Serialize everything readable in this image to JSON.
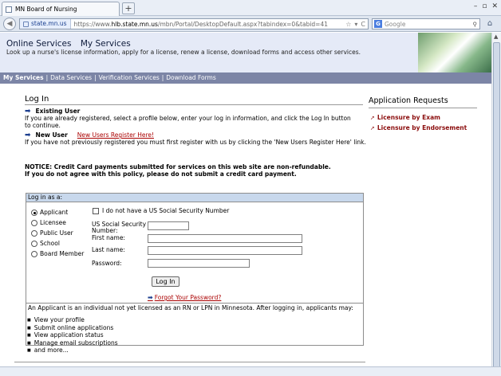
{
  "browser": {
    "tab_title": "MN Board of Nursing",
    "new_tab": "+",
    "window_buttons": [
      "–",
      "▫",
      "✕"
    ],
    "back": "◀",
    "site_identity": "state.mn.us",
    "url_prefix": "https://www.",
    "url_host": "hlb.state.mn.us",
    "url_rest": "/mbn/Portal/DesktopDefault.aspx?tabindex=0&tabid=41",
    "url_icons": [
      "☆",
      "▾",
      "C"
    ],
    "search_engine": "G",
    "search_placeholder": "Google",
    "search_icon": "⚲",
    "home_icon": "⌂"
  },
  "header": {
    "online_services": "Online Services",
    "my_services": "My Services",
    "tagline": "Look up a nurse's license information, apply for a license, renew a license, download forms and access other services."
  },
  "menu": {
    "items": [
      "My Services",
      "Data Services",
      "Verification Services",
      "Download Forms"
    ],
    "separator": "|"
  },
  "login": {
    "title": "Log In",
    "existing_user": "Existing User",
    "existing_text": "If you are already registered, select a profile below, enter your log in information, and click the Log In button to continue.",
    "new_user": "New User",
    "register_link": "New Users Register Here!",
    "new_text": "If you have not previously registered you must first register with us by clicking the 'New Users Register Here' link.",
    "notice1": "NOTICE: Credit Card payments submitted for services on this web site are non-refundable.",
    "notice2": "If you do not agree with this policy, please do not submit a credit card payment."
  },
  "form": {
    "heading": "Log in as a:",
    "profiles": [
      "Applicant",
      "Licensee",
      "Public User",
      "School",
      "Board Member"
    ],
    "selected_profile": "Applicant",
    "no_ssn_label": "I do not have a US Social Security Number",
    "ssn_label": "US Social Security Number:",
    "first_name_label": "First name:",
    "last_name_label": "Last name:",
    "password_label": "Password:",
    "login_button": "Log In",
    "forgot_password": "Forgot Your Password?",
    "note": "An Applicant is an individual not yet licensed as an RN or LPN in Minnesota. After logging in, applicants may:",
    "bullets": [
      "View your profile",
      "Submit online applications",
      "View application status",
      "Manage email subscriptions",
      "and more..."
    ]
  },
  "sidebar": {
    "title": "Application Requests",
    "links": [
      "Licensure by Exam",
      "Licensure by Endorsement"
    ]
  },
  "colors": {
    "menu_bar": "#7c85a6",
    "header_bg": "#e5eaf7",
    "link_red": "#8b0d0d",
    "form_head": "#c8d8ec"
  }
}
